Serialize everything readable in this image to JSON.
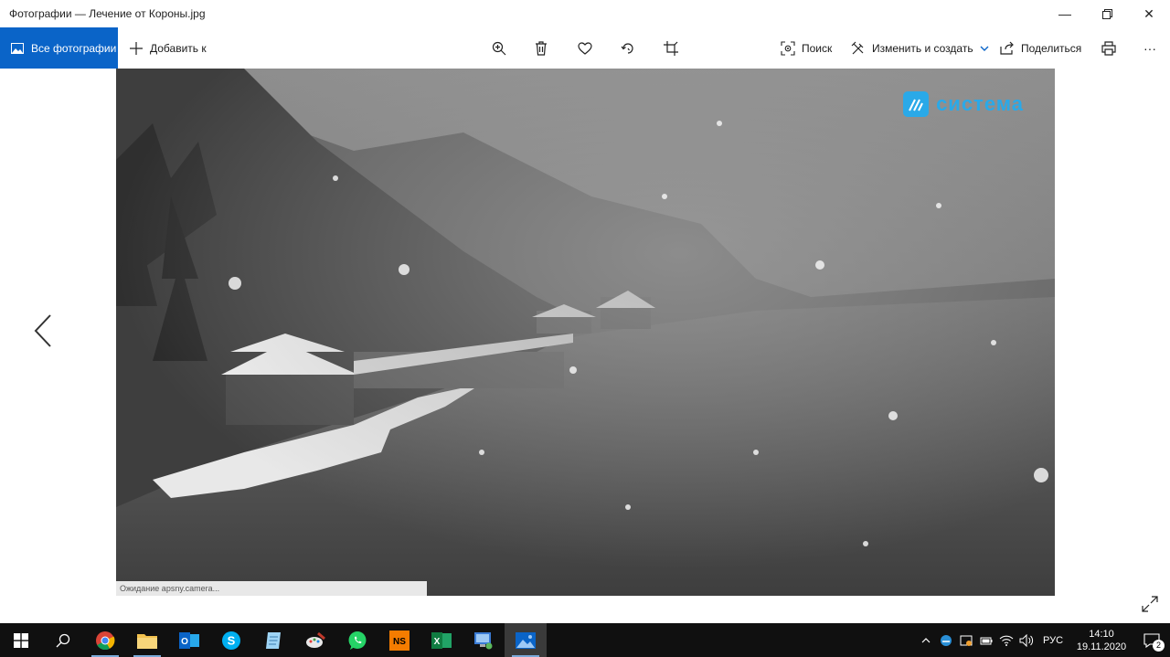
{
  "window": {
    "title": "Фотографии — Лечение от Короны.jpg",
    "minimize_glyph": "—",
    "restore_glyph": "❐",
    "close_glyph": "✕"
  },
  "toolbar": {
    "all_photos_label": "Все фотографии",
    "add_to_label": "Добавить к",
    "search_label": "Поиск",
    "edit_create_label": "Изменить и создать",
    "share_label": "Поделиться",
    "more_glyph": "···",
    "accent": "#0a64c8"
  },
  "photo": {
    "watermark_text": "система",
    "status_text": "Ожидание apsny.camera..."
  },
  "taskbar": {
    "apps": [
      "chrome-icon",
      "file-explorer-icon",
      "outlook-icon",
      "skype-icon",
      "notes-icon",
      "paint-icon",
      "whatsapp-icon",
      "ns-app-icon",
      "excel-icon",
      "remote-desktop-icon",
      "photos-icon"
    ],
    "ns_label": "NS",
    "excel_label": "X",
    "outlook_label": "O",
    "skype_label": "S",
    "language": "РУС",
    "time": "14:10",
    "date": "19.11.2020",
    "notifications_count": "2"
  }
}
